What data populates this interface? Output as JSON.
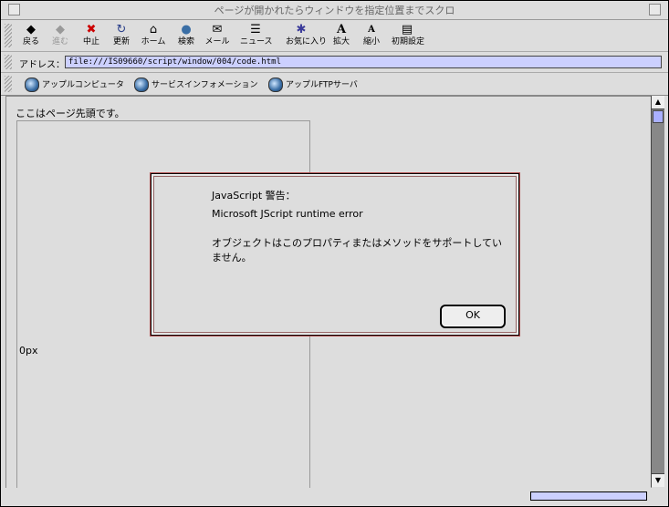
{
  "window": {
    "title": "ページが開かれたらウィンドウを指定位置までスクロ"
  },
  "toolbar": {
    "buttons": [
      {
        "label": "戻る",
        "icon": "back-arrow-icon"
      },
      {
        "label": "進む",
        "icon": "forward-arrow-icon"
      },
      {
        "label": "中止",
        "icon": "stop-icon"
      },
      {
        "label": "更新",
        "icon": "reload-icon"
      },
      {
        "label": "ホーム",
        "icon": "home-icon"
      },
      {
        "label": "検索",
        "icon": "search-globe-icon"
      },
      {
        "label": "メール",
        "icon": "mail-icon"
      },
      {
        "label": "ニュース",
        "icon": "news-icon"
      },
      {
        "label": "お気に入り",
        "icon": "favorites-icon"
      },
      {
        "label": "拡大",
        "icon": "text-larger-icon"
      },
      {
        "label": "縮小",
        "icon": "text-smaller-icon"
      },
      {
        "label": "初期設定",
        "icon": "preferences-icon"
      }
    ]
  },
  "address": {
    "label": "アドレス：",
    "value": "file:///IS09660/script/window/004/code.html"
  },
  "favorites": [
    {
      "label": "アップルコンピュータ"
    },
    {
      "label": "サービスインフォメーション"
    },
    {
      "label": "アップルFTPサーバ"
    }
  ],
  "content": {
    "heading": "ここはページ先頭です。",
    "offset_label": "0px"
  },
  "dialog": {
    "title": "JavaScript 警告：",
    "error": "Microsoft JScript runtime error",
    "message": "オブジェクトはこのプロパティまたはメソッドをサポートしていません。",
    "ok_label": "OK"
  },
  "colors": {
    "accent": "#ccd0ff",
    "dialog_border": "#ae4a4a"
  }
}
